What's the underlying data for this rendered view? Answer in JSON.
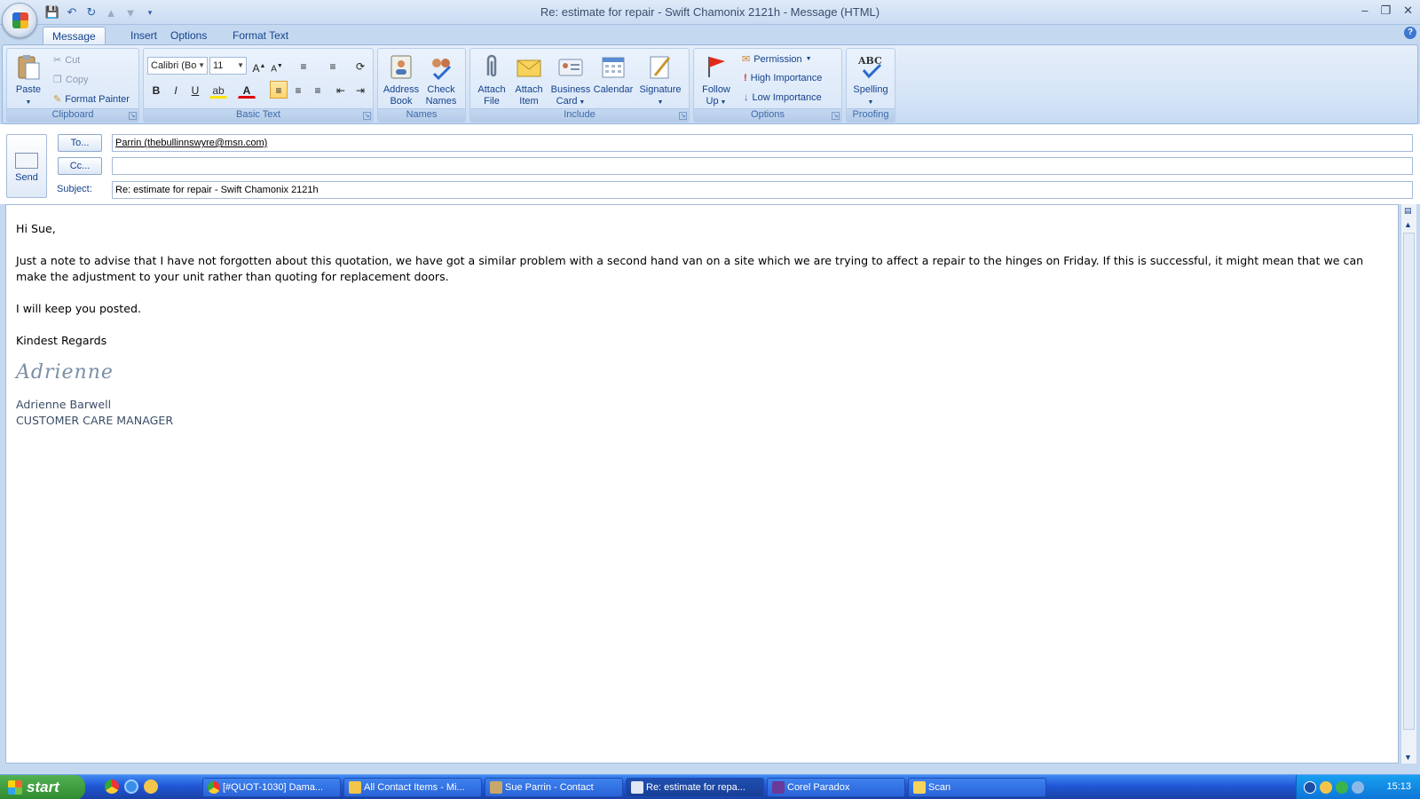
{
  "window": {
    "title": "Re: estimate for repair - Swift Chamonix 2121h - Message (HTML)",
    "controls": [
      "minimize-icon",
      "restore-icon",
      "close-icon"
    ]
  },
  "qat": [
    "save-icon",
    "undo-icon",
    "redo-icon",
    "prev-icon",
    "next-icon",
    "customize-icon"
  ],
  "tabs": [
    "Message",
    "Insert",
    "Options",
    "Format Text"
  ],
  "ribbon": {
    "clipboard": {
      "label": "Clipboard",
      "paste": "Paste",
      "cut": "Cut",
      "copy": "Copy",
      "format_painter": "Format Painter"
    },
    "basic_text": {
      "label": "Basic Text",
      "font": "Calibri (Bo",
      "size": "11"
    },
    "names": {
      "label": "Names",
      "address_book_1": "Address",
      "address_book_2": "Book",
      "check_names_1": "Check",
      "check_names_2": "Names"
    },
    "include": {
      "label": "Include",
      "attach_file_1": "Attach",
      "attach_file_2": "File",
      "attach_item_1": "Attach",
      "attach_item_2": "Item",
      "business_card_1": "Business",
      "business_card_2": "Card",
      "calendar": "Calendar",
      "signature": "Signature"
    },
    "options": {
      "label": "Options",
      "follow_up_1": "Follow",
      "follow_up_2": "Up",
      "permission": "Permission",
      "high": "High Importance",
      "low": "Low Importance"
    },
    "proofing": {
      "label": "Proofing",
      "spelling": "Spelling",
      "abc": "ABC"
    }
  },
  "header": {
    "send": "Send",
    "to_label": "To...",
    "cc_label": "Cc...",
    "subject_label": "Subject:",
    "to_value": "Parrin (thebullinnswyre@msn.com)",
    "cc_value": "",
    "subject_value": "Re: estimate for repair - Swift Chamonix 2121h"
  },
  "message": {
    "greeting": "Hi Sue,",
    "para1": "Just a note to advise that I have not forgotten about this quotation, we have got a similar problem with a second hand van on a site which we are trying to affect a repair to the hinges on Friday.  If this is successful, it might mean that we can make the adjustment to your unit rather than quoting for replacement doors.",
    "para2": "I will keep you posted.",
    "closing": "Kindest Regards",
    "script_signature": "Adrienne",
    "sig_name": "Adrienne Barwell",
    "sig_title": "CUSTOMER CARE MANAGER"
  },
  "taskbar": {
    "start": "start",
    "tasks": [
      "[#QUOT-1030] Dama...",
      "All Contact Items - Mi...",
      "Sue Parrin - Contact",
      "Re: estimate for repa...",
      "Corel Paradox",
      "Scan"
    ],
    "clock": "15:13"
  }
}
